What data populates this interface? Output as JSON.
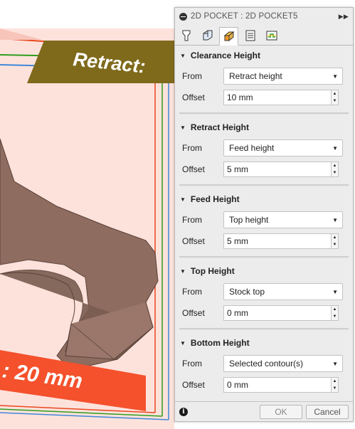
{
  "viewport": {
    "retract_label": "Retract:",
    "bottom_label": ": 20 mm"
  },
  "panel": {
    "title": "2D POCKET : 2D POCKET5",
    "tabs": [
      {
        "name": "tool-tab-icon"
      },
      {
        "name": "geometry-tab-icon"
      },
      {
        "name": "heights-tab-icon",
        "active": true
      },
      {
        "name": "passes-tab-icon"
      },
      {
        "name": "linking-tab-icon"
      }
    ],
    "from_label": "From",
    "offset_label": "Offset",
    "sections": {
      "clearance": {
        "title": "Clearance Height",
        "from": "Retract height",
        "offset": "10 mm"
      },
      "retract": {
        "title": "Retract Height",
        "from": "Feed height",
        "offset": "5 mm"
      },
      "feed": {
        "title": "Feed Height",
        "from": "Top height",
        "offset": "5 mm"
      },
      "top": {
        "title": "Top Height",
        "from": "Stock top",
        "offset": "0 mm"
      },
      "bottom": {
        "title": "Bottom Height",
        "from": "Selected contour(s)",
        "offset": "0 mm"
      }
    },
    "ok_label": "OK",
    "cancel_label": "Cancel",
    "info_glyph": "i"
  },
  "colors": {
    "retract_plane": "#7f6a1c",
    "bottom_plane": "#f4512c",
    "part": "#8e6c5f",
    "clearance_line": "#e8481f",
    "feed_line": "#2e9d1f",
    "top_line": "#3f87d8",
    "stock_fill": "#fde2dc"
  }
}
